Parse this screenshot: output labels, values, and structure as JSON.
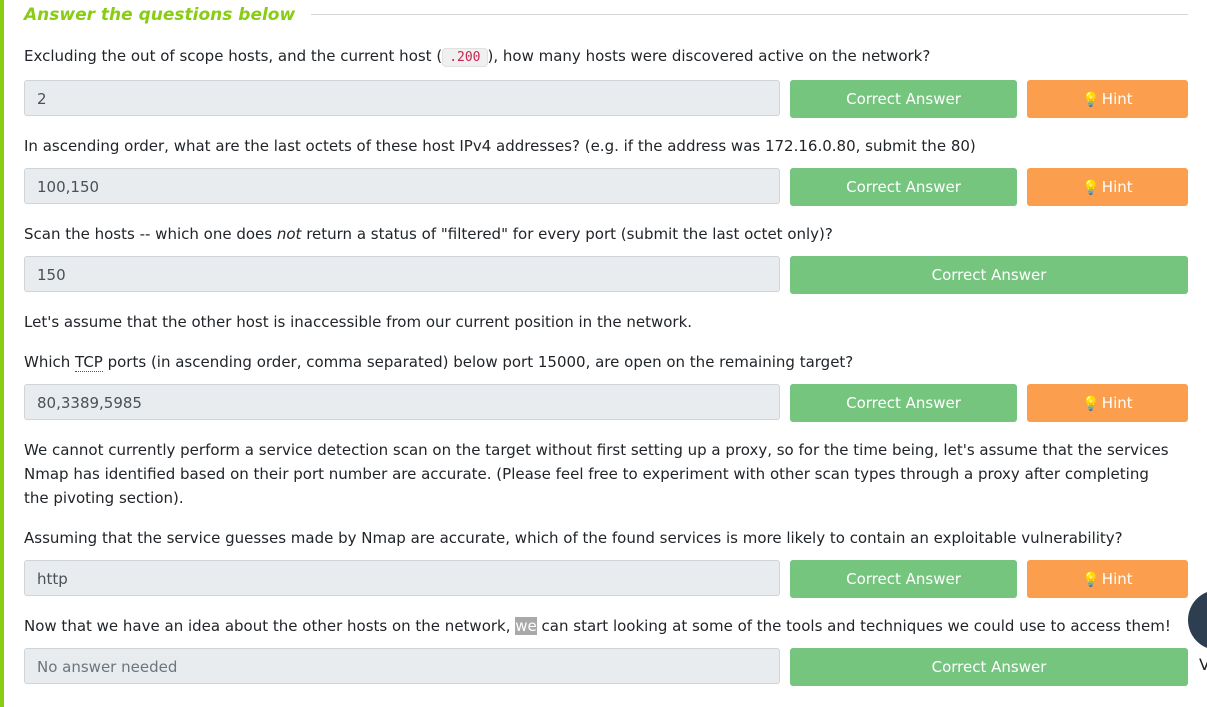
{
  "header": {
    "title": "Answer the questions below"
  },
  "questions": [
    {
      "text_before": "Excluding the out of scope hosts, and the current host (",
      "code": ".200",
      "text_after": "), how many hosts were discovered active on the network?",
      "answer": "2",
      "correct_label": "Correct Answer",
      "hint_label": "Hint"
    },
    {
      "text": "In ascending order, what are the last octets of these host IPv4 addresses? (e.g. if the address was 172.16.0.80, submit the 80)",
      "answer": "100,150",
      "correct_label": "Correct Answer",
      "hint_label": "Hint"
    },
    {
      "text_before": "Scan the hosts -- which one does ",
      "emphasis": "not",
      "text_after": " return a status of \"filtered\" for every port (submit the last octet only)?",
      "answer": "150",
      "correct_label": "Correct Answer"
    },
    {
      "text": "Let's assume that the other host is inaccessible from our current position in the network."
    },
    {
      "text_before": "Which ",
      "abbr": "TCP",
      "text_after": " ports (in ascending order, comma separated) below port 15000, are open on the remaining target?",
      "answer": "80,3389,5985",
      "correct_label": "Correct Answer",
      "hint_label": "Hint"
    },
    {
      "text": "We cannot currently perform a service detection scan on the target without first setting up a proxy, so for the time being, let's assume that the services Nmap has identified based on their port number are accurate. (Please feel free to experiment with other scan types through a proxy after completing the pivoting section)."
    },
    {
      "text": "Assuming that the service guesses made by Nmap are accurate, which of the found services is more likely to contain an exploitable vulnerability?",
      "answer": "http",
      "correct_label": "Correct Answer",
      "hint_label": "Hint"
    },
    {
      "text_before": "Now that we have an idea about the other hosts on the network, ",
      "highlight": "we",
      "text_after": " can start looking at some of the tools and techniques we could use to access them!",
      "placeholder": "No answer needed",
      "correct_label": "Correct Answer"
    }
  ],
  "edge_glyph": "V",
  "colors": {
    "accent_green": "#88cc14",
    "correct_button": "#76c57f",
    "hint_button": "#fb9e4d",
    "code_text": "#c7254e",
    "chat_bubble": "#2c3e50"
  },
  "icons": {
    "hint": "lightbulb-icon",
    "chat": "chat-bubble-icon"
  }
}
